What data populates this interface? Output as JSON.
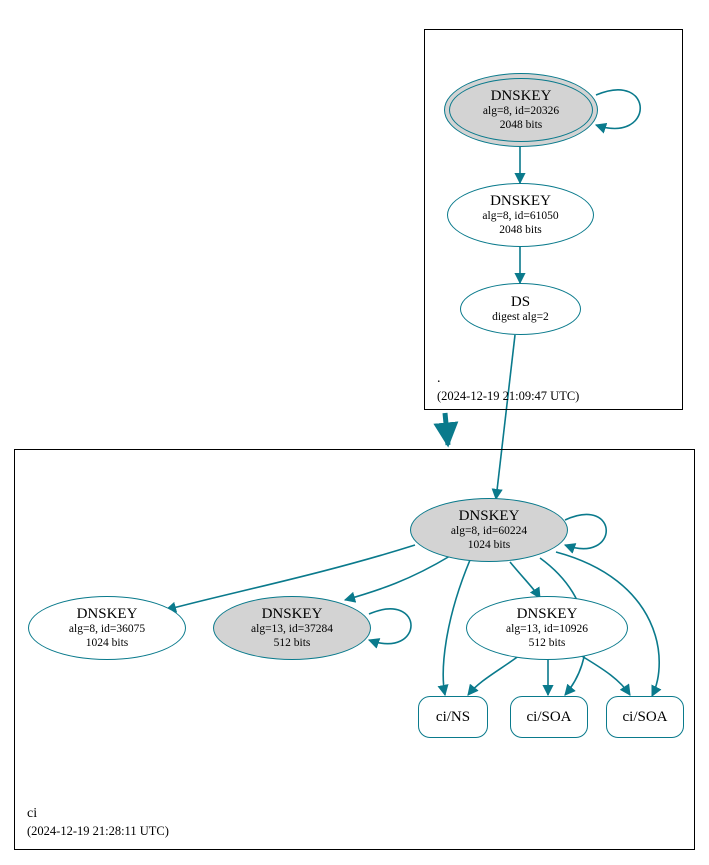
{
  "colors": {
    "stroke": "#0a7a8c",
    "fillGray": "#d3d3d3"
  },
  "zones": {
    "root": {
      "name": ".",
      "timestamp": "(2024-12-19 21:09:47 UTC)"
    },
    "ci": {
      "name": "ci",
      "timestamp": "(2024-12-19 21:28:11 UTC)"
    }
  },
  "nodes": {
    "root_ksk": {
      "title": "DNSKEY",
      "line1": "alg=8, id=20326",
      "line2": "2048 bits"
    },
    "root_zsk": {
      "title": "DNSKEY",
      "line1": "alg=8, id=61050",
      "line2": "2048 bits"
    },
    "root_ds": {
      "title": "DS",
      "line1": "digest alg=2"
    },
    "ci_ksk": {
      "title": "DNSKEY",
      "line1": "alg=8, id=60224",
      "line2": "1024 bits"
    },
    "ci_k_36075": {
      "title": "DNSKEY",
      "line1": "alg=8, id=36075",
      "line2": "1024 bits"
    },
    "ci_k_37284": {
      "title": "DNSKEY",
      "line1": "alg=13, id=37284",
      "line2": "512 bits"
    },
    "ci_k_10926": {
      "title": "DNSKEY",
      "line1": "alg=13, id=10926",
      "line2": "512 bits"
    },
    "rr_ns": {
      "label": "ci/NS"
    },
    "rr_soa1": {
      "label": "ci/SOA"
    },
    "rr_soa2": {
      "label": "ci/SOA"
    }
  }
}
